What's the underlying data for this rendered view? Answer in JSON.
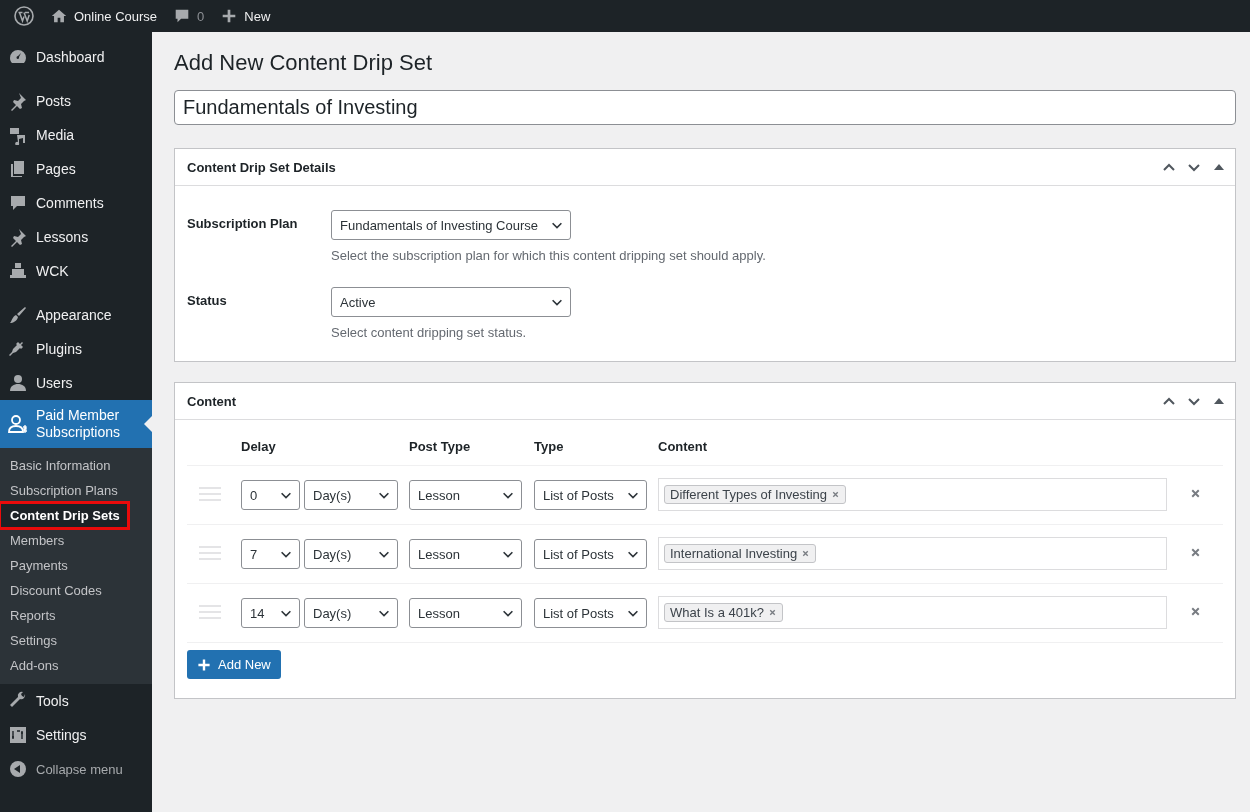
{
  "admin_bar": {
    "site_name": "Online Course",
    "comments_count": "0",
    "new_label": "New"
  },
  "sidebar": {
    "groups": [
      [
        {
          "label": "Dashboard",
          "selected": false
        }
      ],
      [
        {
          "label": "Posts",
          "selected": false
        },
        {
          "label": "Media",
          "selected": false
        },
        {
          "label": "Pages",
          "selected": false
        },
        {
          "label": "Comments",
          "selected": false
        },
        {
          "label": "Lessons",
          "selected": false
        },
        {
          "label": "WCK",
          "selected": false
        }
      ],
      [
        {
          "label": "Appearance",
          "selected": false
        },
        {
          "label": "Plugins",
          "selected": false
        },
        {
          "label": "Users",
          "selected": false
        },
        {
          "label": "Paid Member Subscriptions",
          "selected": true,
          "submenu": [
            {
              "label": "Basic Information",
              "selected": false,
              "highlighted": false
            },
            {
              "label": "Subscription Plans",
              "selected": false,
              "highlighted": false
            },
            {
              "label": "Content Drip Sets",
              "selected": true,
              "highlighted": true
            },
            {
              "label": "Members",
              "selected": false,
              "highlighted": false
            },
            {
              "label": "Payments",
              "selected": false,
              "highlighted": false
            },
            {
              "label": "Discount Codes",
              "selected": false,
              "highlighted": false
            },
            {
              "label": "Reports",
              "selected": false,
              "highlighted": false
            },
            {
              "label": "Settings",
              "selected": false,
              "highlighted": false
            },
            {
              "label": "Add-ons",
              "selected": false,
              "highlighted": false
            }
          ]
        },
        {
          "label": "Tools",
          "selected": false
        },
        {
          "label": "Settings",
          "selected": false
        }
      ]
    ],
    "collapse_label": "Collapse menu"
  },
  "page": {
    "heading": "Add New Content Drip Set",
    "title_value": "Fundamentals of Investing",
    "details_box": {
      "title": "Content Drip Set Details",
      "fields": [
        {
          "label": "Subscription Plan",
          "value": "Fundamentals of Investing Course",
          "description": "Select the subscription plan for which this content dripping set should apply."
        },
        {
          "label": "Status",
          "value": "Active",
          "description": "Select content dripping set status."
        }
      ]
    },
    "content_box": {
      "title": "Content",
      "columns": [
        "Delay",
        "Post Type",
        "Type",
        "Content"
      ],
      "rows": [
        {
          "delay": "0",
          "unit": "Day(s)",
          "post_type": "Lesson",
          "type": "List of Posts",
          "items": [
            "Different Types of Investing"
          ]
        },
        {
          "delay": "7",
          "unit": "Day(s)",
          "post_type": "Lesson",
          "type": "List of Posts",
          "items": [
            "International Investing"
          ]
        },
        {
          "delay": "14",
          "unit": "Day(s)",
          "post_type": "Lesson",
          "type": "List of Posts",
          "items": [
            "What Is a 401k?"
          ]
        }
      ],
      "add_button": "Add New"
    }
  }
}
